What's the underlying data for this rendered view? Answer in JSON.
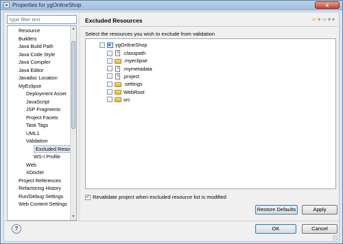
{
  "window": {
    "title": "Properties for ygOnlineShop",
    "close_label": "x"
  },
  "filter": {
    "placeholder": "type filter text"
  },
  "nav": {
    "items": [
      {
        "label": "Resource",
        "level": 0
      },
      {
        "label": "Builders",
        "level": 0
      },
      {
        "label": "Java Build Path",
        "level": 0
      },
      {
        "label": "Java Code Style",
        "level": 0
      },
      {
        "label": "Java Compiler",
        "level": 0
      },
      {
        "label": "Java Editor",
        "level": 0
      },
      {
        "label": "Javadoc Location",
        "level": 0
      },
      {
        "label": "MyEclipse",
        "level": 0
      },
      {
        "label": "Deployment Asser",
        "level": 1
      },
      {
        "label": "JavaScript",
        "level": 1
      },
      {
        "label": "JSP Fragments",
        "level": 1
      },
      {
        "label": "Project Facets",
        "level": 1
      },
      {
        "label": "Task Tags",
        "level": 1
      },
      {
        "label": "UML1",
        "level": 1
      },
      {
        "label": "Validation",
        "level": 1
      },
      {
        "label": "Excluded Resou",
        "level": 2,
        "selected": true
      },
      {
        "label": "WS-I Profile",
        "level": 2
      },
      {
        "label": "Web",
        "level": 1
      },
      {
        "label": "XDoclet",
        "level": 1
      },
      {
        "label": "Project References",
        "level": 0
      },
      {
        "label": "Refactoring History",
        "level": 0
      },
      {
        "label": "Run/Debug Settings",
        "level": 0
      },
      {
        "label": "Web Content Settings",
        "level": 0
      }
    ]
  },
  "page": {
    "title": "Excluded Resources",
    "description": "Select the resources you wish to exclude from validation",
    "nav_back_icon": "back-arrow-icon",
    "nav_forward_icon": "forward-arrow-icon"
  },
  "resources": {
    "root": {
      "label": "ygOnlineShop",
      "icon": "project-icon",
      "checked": false
    },
    "children": [
      {
        "label": ".classpath",
        "icon": "file-icon",
        "checked": false
      },
      {
        "label": ".myeclipse",
        "icon": "folder-icon",
        "checked": false
      },
      {
        "label": ".mymetadata",
        "icon": "file-icon",
        "checked": false
      },
      {
        "label": ".project",
        "icon": "file-icon",
        "checked": false
      },
      {
        "label": ".settings",
        "icon": "folder-icon",
        "checked": false
      },
      {
        "label": "WebRoot",
        "icon": "folder-icon",
        "checked": false
      },
      {
        "label": "src",
        "icon": "folder-icon",
        "checked": false
      }
    ]
  },
  "revalidate": {
    "label": "Revalidate project when excluded resource list is modified",
    "checked": true
  },
  "buttons": {
    "restore": "Restore Defaults",
    "apply": "Apply",
    "ok": "OK",
    "cancel": "Cancel",
    "help": "?"
  }
}
